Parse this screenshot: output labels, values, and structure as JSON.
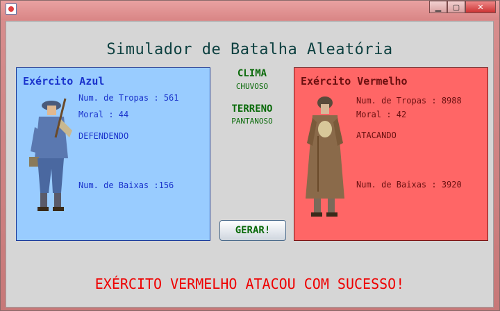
{
  "window": {
    "title": "",
    "minimize_label": "▁",
    "maximize_label": "▢",
    "close_label": "✕"
  },
  "app": {
    "title": "Simulador de Batalha Aleatória"
  },
  "blue_army": {
    "name": "Exército Azul",
    "troops": "Num. de Tropas : 561",
    "morale": "Moral : 44",
    "status": "DEFENDENDO",
    "casualties": "Num. de Baixas :156"
  },
  "red_army": {
    "name": "Exército Vermelho",
    "troops": "Num. de Tropas : 8988",
    "morale": "Moral : 42",
    "status": "ATACANDO",
    "casualties": "Num. de Baixas : 3920"
  },
  "conditions": {
    "climate_label": "CLIMA",
    "climate_value": "CHUVOSO",
    "terrain_label": "TERRENO",
    "terrain_value": "PANTANOSO"
  },
  "actions": {
    "generate_label": "GERAR!"
  },
  "result": {
    "message": "EXÉRCITO VERMELHO ATACOU COM SUCESSO!"
  },
  "colors": {
    "blue_panel": "#99ccff",
    "red_panel": "#ff6666",
    "result_text": "#ee0000",
    "condition_text": "#0a6a0a"
  }
}
